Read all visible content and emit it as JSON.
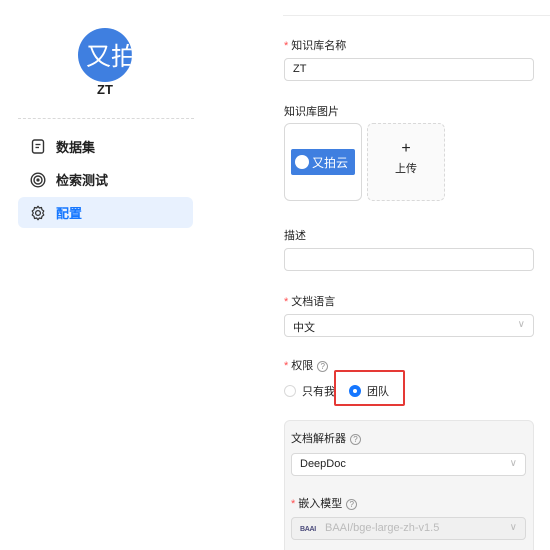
{
  "sidebar": {
    "avatar_text": "又拍",
    "kb_name": "ZT",
    "items": [
      {
        "label": "数据集",
        "icon": "file-icon",
        "active": false
      },
      {
        "label": "检索测试",
        "icon": "target-icon",
        "active": false
      },
      {
        "label": "配置",
        "icon": "gear-icon",
        "active": true
      }
    ]
  },
  "form": {
    "kb_name_label": "知识库名称",
    "kb_name_value": "ZT",
    "image_label": "知识库图片",
    "image_logo_text": "又拍云",
    "upload_plus": "+",
    "upload_label": "上传",
    "description_label": "描述",
    "description_value": "",
    "language_label": "文档语言",
    "language_value": "中文",
    "permission_label": "权限",
    "permission_options": [
      "只有我",
      "团队"
    ],
    "permission_selected": "团队",
    "parser_label": "文档解析器",
    "parser_value": "DeepDoc",
    "embedding_label": "嵌入模型",
    "embedding_brand": "BAAI",
    "embedding_value": "BAAI/bge-large-zh-v1.5",
    "help_glyph": "?",
    "required_mark": "*",
    "chevron_glyph": "∨"
  },
  "colors": {
    "accent": "#1677ff",
    "active_bg": "#e8f1fe",
    "required": "#ff4d4f",
    "highlight": "#e53935",
    "brand": "#3f7fe0"
  }
}
